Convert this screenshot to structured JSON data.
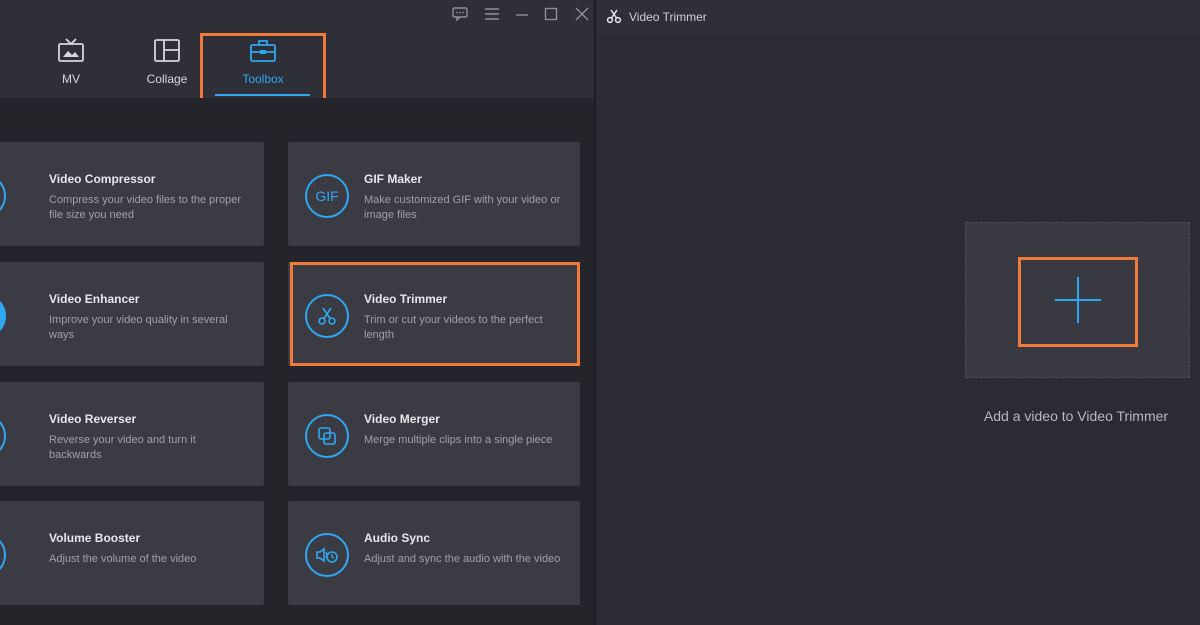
{
  "window": {
    "controls": [
      {
        "name": "feedback-icon"
      },
      {
        "name": "menu-icon"
      },
      {
        "name": "minimize-icon"
      },
      {
        "name": "maximize-icon"
      },
      {
        "name": "close-icon"
      }
    ]
  },
  "tabs": [
    {
      "label": "MV",
      "icon": "mv-icon"
    },
    {
      "label": "Collage",
      "icon": "collage-icon"
    },
    {
      "label": "Toolbox",
      "icon": "toolbox-icon",
      "active": true
    }
  ],
  "tools": [
    {
      "title": "Video Compressor",
      "desc": "Compress your video files to the proper file size you need",
      "icon": "compress-icon"
    },
    {
      "title": "GIF Maker",
      "desc": "Make customized GIF with your video or image files",
      "icon": "gif-icon"
    },
    {
      "title": "Video Enhancer",
      "desc": "Improve your video quality in several ways",
      "icon": "palette-icon"
    },
    {
      "title": "Video Trimmer",
      "desc": "Trim or cut your videos to the perfect length",
      "icon": "scissors-icon"
    },
    {
      "title": "Video Reverser",
      "desc": "Reverse your video and turn it backwards",
      "icon": "rewind-icon"
    },
    {
      "title": "Video Merger",
      "desc": "Merge multiple clips into a single piece",
      "icon": "merge-icon"
    },
    {
      "title": "Volume Booster",
      "desc": "Adjust the volume of the video",
      "icon": "volume-icon"
    },
    {
      "title": "Audio Sync",
      "desc": "Adjust and sync the audio with the video",
      "icon": "audio-sync-icon"
    }
  ],
  "trimmer_panel": {
    "title": "Video Trimmer",
    "add_caption": "Add a video to Video Trimmer"
  },
  "colors": {
    "accent": "#2fa8f3",
    "highlight": "#f07a3a",
    "background": "#24252b",
    "card": "#3a3b43"
  }
}
